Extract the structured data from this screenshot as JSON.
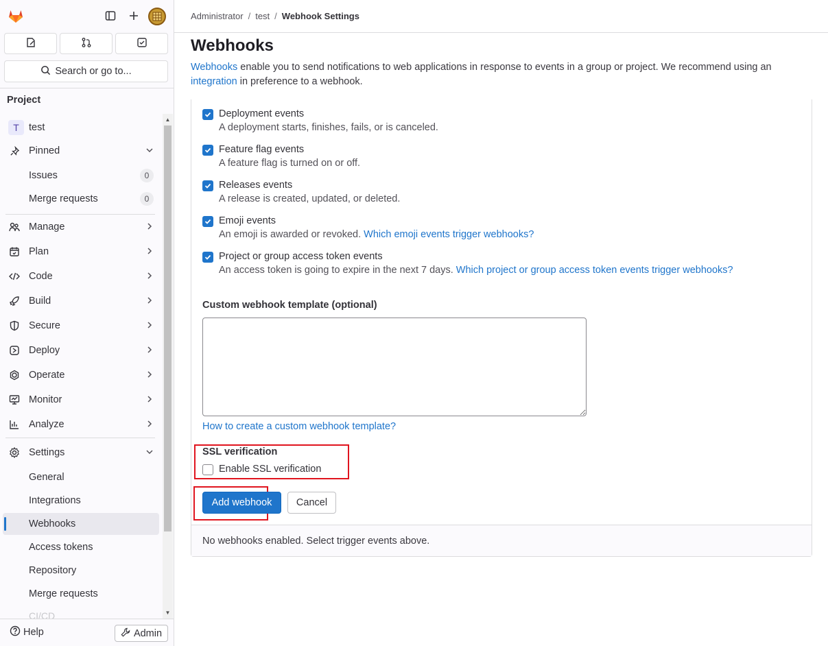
{
  "nav_top": {
    "logo": "gitlab-tanuki-logo",
    "sidebar_toggle": "sidebar-toggle-icon",
    "new": "plus-icon",
    "avatar": "user-avatar"
  },
  "quick": {
    "items": [
      "issues-icon",
      "merge-request-icon",
      "todo-icon"
    ]
  },
  "search": {
    "label": "Search or go to..."
  },
  "sidebar": {
    "section_title": "Project",
    "project": {
      "badge": "T",
      "name": "test"
    },
    "pinned": {
      "label": "Pinned",
      "items": [
        {
          "label": "Issues",
          "count": "0"
        },
        {
          "label": "Merge requests",
          "count": "0"
        }
      ]
    },
    "groups": [
      {
        "label": "Manage"
      },
      {
        "label": "Plan"
      },
      {
        "label": "Code"
      },
      {
        "label": "Build"
      },
      {
        "label": "Secure"
      },
      {
        "label": "Deploy"
      },
      {
        "label": "Operate"
      },
      {
        "label": "Monitor"
      },
      {
        "label": "Analyze"
      }
    ],
    "settings": {
      "label": "Settings",
      "items": [
        {
          "label": "General"
        },
        {
          "label": "Integrations"
        },
        {
          "label": "Webhooks"
        },
        {
          "label": "Access tokens"
        },
        {
          "label": "Repository"
        },
        {
          "label": "Merge requests"
        }
      ],
      "faded": "CI/CD"
    },
    "help": "Help",
    "admin": "Admin"
  },
  "breadcrumb": [
    "Administrator",
    "test",
    "Webhook Settings"
  ],
  "page": {
    "title": "Webhooks",
    "intro_link1": "Webhooks",
    "intro_text1": " enable you to send notifications to web applications in response to events in a group or project. We recommend using an ",
    "intro_link2": "integration",
    "intro_text2": " in preference to a webhook."
  },
  "events": [
    {
      "label": "Deployment events",
      "help": "A deployment starts, finishes, fails, or is canceled.",
      "link": "",
      "checked": true
    },
    {
      "label": "Feature flag events",
      "help": "A feature flag is turned on or off.",
      "link": "",
      "checked": true
    },
    {
      "label": "Releases events",
      "help": "A release is created, updated, or deleted.",
      "link": "",
      "checked": true
    },
    {
      "label": "Emoji events",
      "help": "An emoji is awarded or revoked. ",
      "link": "Which emoji events trigger webhooks?",
      "checked": true
    },
    {
      "label": "Project or group access token events",
      "help": "An access token is going to expire in the next 7 days. ",
      "link": "Which project or group access token events trigger webhooks?",
      "checked": true
    }
  ],
  "template": {
    "label": "Custom webhook template (optional)",
    "value": "",
    "help_link": "How to create a custom webhook template?"
  },
  "ssl": {
    "label": "SSL verification",
    "checkbox_label": "Enable SSL verification",
    "checked": false
  },
  "actions": {
    "submit": "Add webhook",
    "cancel": "Cancel"
  },
  "footer": {
    "empty": "No webhooks enabled. Select trigger events above."
  },
  "colors": {
    "accent": "#1f75cb",
    "highlight": "#e0141e"
  }
}
